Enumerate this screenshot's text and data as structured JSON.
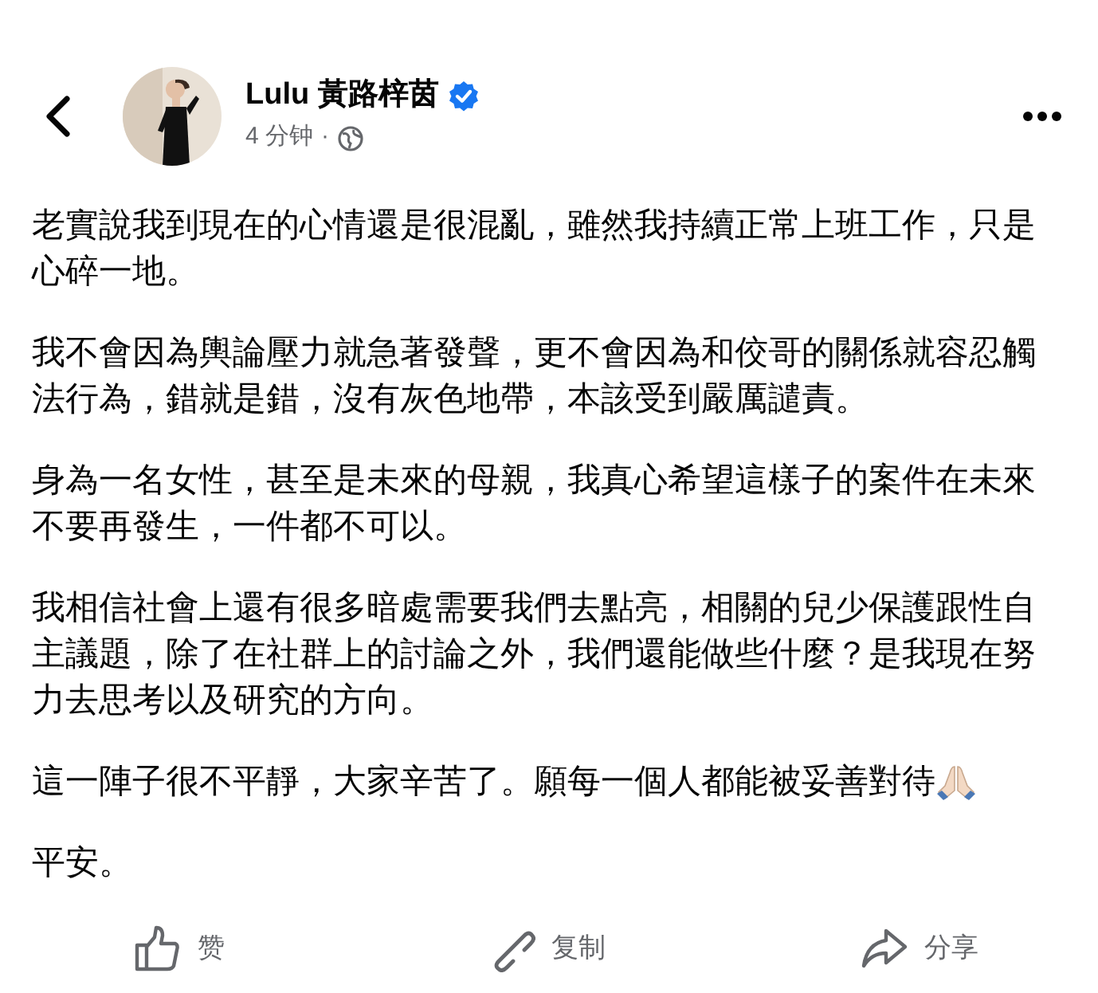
{
  "header": {
    "author": {
      "name": "Lulu 黃路梓茵",
      "verified": true
    },
    "time": "4 分钟",
    "separator": "·"
  },
  "paragraphs": [
    {
      "kind": "text",
      "text": "老實說我到現在的心情還是很混亂，雖然我持續正常上班工作，只是心碎一地。"
    },
    {
      "kind": "text",
      "text": "我不會因為輿論壓力就急著發聲，更不會因為和佼哥的關係就容忍觸法行為，錯就是錯，沒有灰色地帶，本該受到嚴厲譴責。"
    },
    {
      "kind": "text",
      "text": "身為一名女性，甚至是未來的母親，我真心希望這樣子的案件在未來不要再發生，一件都不可以。"
    },
    {
      "kind": "text",
      "text": "我相信社會上還有很多暗處需要我們去點亮，相關的兒少保護跟性自主議題，除了在社群上的討論之外，我們還能做些什麼？是我現在努力去思考以及研究的方向。"
    },
    {
      "kind": "with_emoji",
      "text": "這一陣子很不平靜，大家辛苦了。願每一個人都能被妥善對待"
    },
    {
      "kind": "text",
      "text": "平安。"
    }
  ],
  "actions": [
    {
      "kind": "like",
      "label": "赞"
    },
    {
      "kind": "copy",
      "label": "复制"
    },
    {
      "kind": "share",
      "label": "分享"
    }
  ]
}
